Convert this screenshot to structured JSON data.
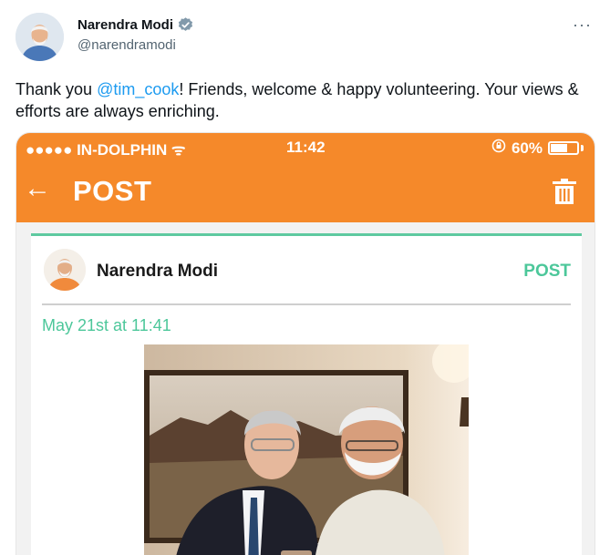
{
  "tweet": {
    "display_name": "Narendra Modi",
    "handle": "@narendramodi",
    "more_glyph": "···",
    "text_before": "Thank you ",
    "mention": "@tim_cook",
    "text_after": "! Friends, welcome & happy volunteering. Your views & efforts are always enriching.",
    "verified_icon": "verified-badge-icon",
    "colors": {
      "mention": "#1d9bf0",
      "handle": "#536471"
    }
  },
  "media": {
    "status_bar": {
      "carrier": "●●●●● IN-DOLPHIN ᯤ",
      "time": "11:42",
      "battery": "60%",
      "battery_level": 0.6
    },
    "app_bar": {
      "back_glyph": "←",
      "title": "POST",
      "trash_icon": "trash-icon",
      "color": "#f5892a"
    },
    "card": {
      "author": "Narendra Modi",
      "action": "POST",
      "timestamp": "May 21st  at 11:41",
      "accent": "#4cc79a"
    }
  }
}
